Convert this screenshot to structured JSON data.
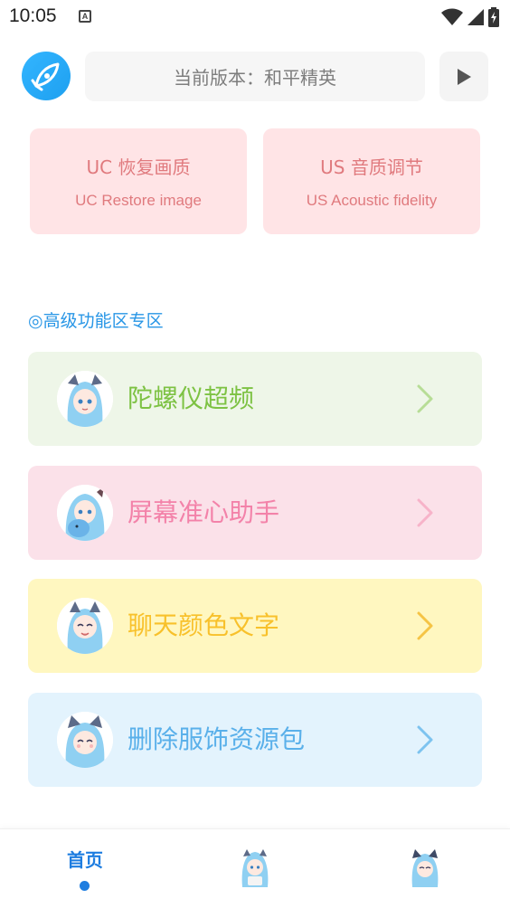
{
  "status_bar": {
    "time": "10:05",
    "notification_letter": "A"
  },
  "header": {
    "version_text": "当前版本：和平精英"
  },
  "feature_cards": [
    {
      "title": "UC 恢复画质",
      "subtitle": "UC Restore image"
    },
    {
      "title": "US 音质调节",
      "subtitle": "US Acoustic fidelity"
    }
  ],
  "section_title": "◎高级功能区专区",
  "functions": [
    {
      "label": "陀螺仪超频",
      "color": "#7dc243"
    },
    {
      "label": "屏幕准心助手",
      "color": "#f382a9"
    },
    {
      "label": "聊天颜色文字",
      "color": "#f8c12b"
    },
    {
      "label": "删除服饰资源包",
      "color": "#5ab0ea"
    }
  ],
  "bottom_nav": {
    "home_label": "首页",
    "accent": "#1e7de0"
  },
  "icons": {
    "logo": "rocket-icon",
    "play": "play-icon",
    "chevron": "chevron-right-icon",
    "wifi": "wifi-icon",
    "signal": "signal-icon",
    "battery": "battery-charging-icon"
  }
}
